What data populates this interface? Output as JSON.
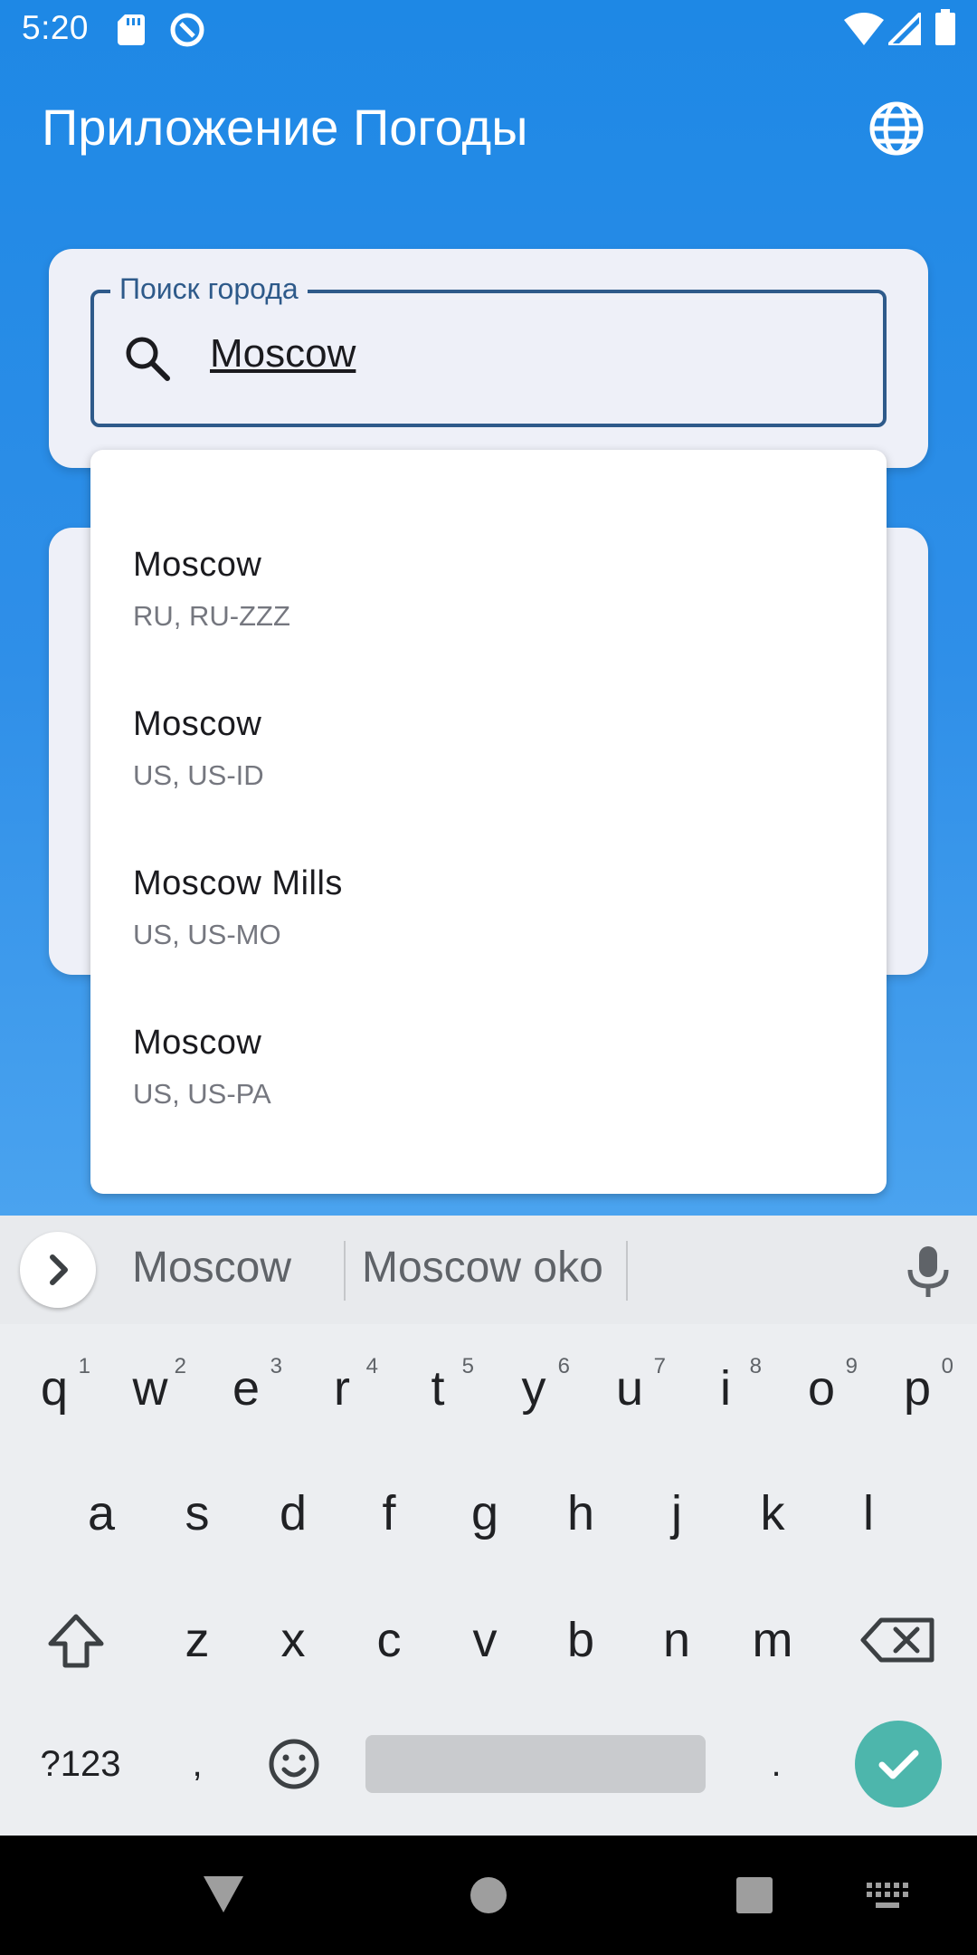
{
  "status_bar": {
    "time": "5:20",
    "icons": [
      "sd-card-icon",
      "data-saver-icon",
      "wifi-icon",
      "signal-icon",
      "battery-icon"
    ]
  },
  "app_bar": {
    "title": "Приложение Погоды",
    "language_icon": "globe-icon"
  },
  "search": {
    "label": "Поиск города",
    "value": "Moscow",
    "icon": "search-icon"
  },
  "suggestions": [
    {
      "city": "Moscow",
      "region": "RU, RU-ZZZ"
    },
    {
      "city": "Moscow",
      "region": "US, US-ID"
    },
    {
      "city": "Moscow Mills",
      "region": "US, US-MO"
    },
    {
      "city": "Moscow",
      "region": "US, US-PA"
    }
  ],
  "keyboard": {
    "strip_words": [
      "Moscow",
      "Moscow oko"
    ],
    "row1": [
      {
        "k": "q",
        "n": "1"
      },
      {
        "k": "w",
        "n": "2"
      },
      {
        "k": "e",
        "n": "3"
      },
      {
        "k": "r",
        "n": "4"
      },
      {
        "k": "t",
        "n": "5"
      },
      {
        "k": "y",
        "n": "6"
      },
      {
        "k": "u",
        "n": "7"
      },
      {
        "k": "i",
        "n": "8"
      },
      {
        "k": "o",
        "n": "9"
      },
      {
        "k": "p",
        "n": "0"
      }
    ],
    "row2": [
      "a",
      "s",
      "d",
      "f",
      "g",
      "h",
      "j",
      "k",
      "l"
    ],
    "row3": [
      "z",
      "x",
      "c",
      "v",
      "b",
      "n",
      "m"
    ],
    "symbols_label": "?123",
    "comma": ",",
    "period": "."
  },
  "colors": {
    "app_bar": "#1e88e5",
    "outline": "#2e5a8a",
    "enter_key": "#4db6ac"
  }
}
